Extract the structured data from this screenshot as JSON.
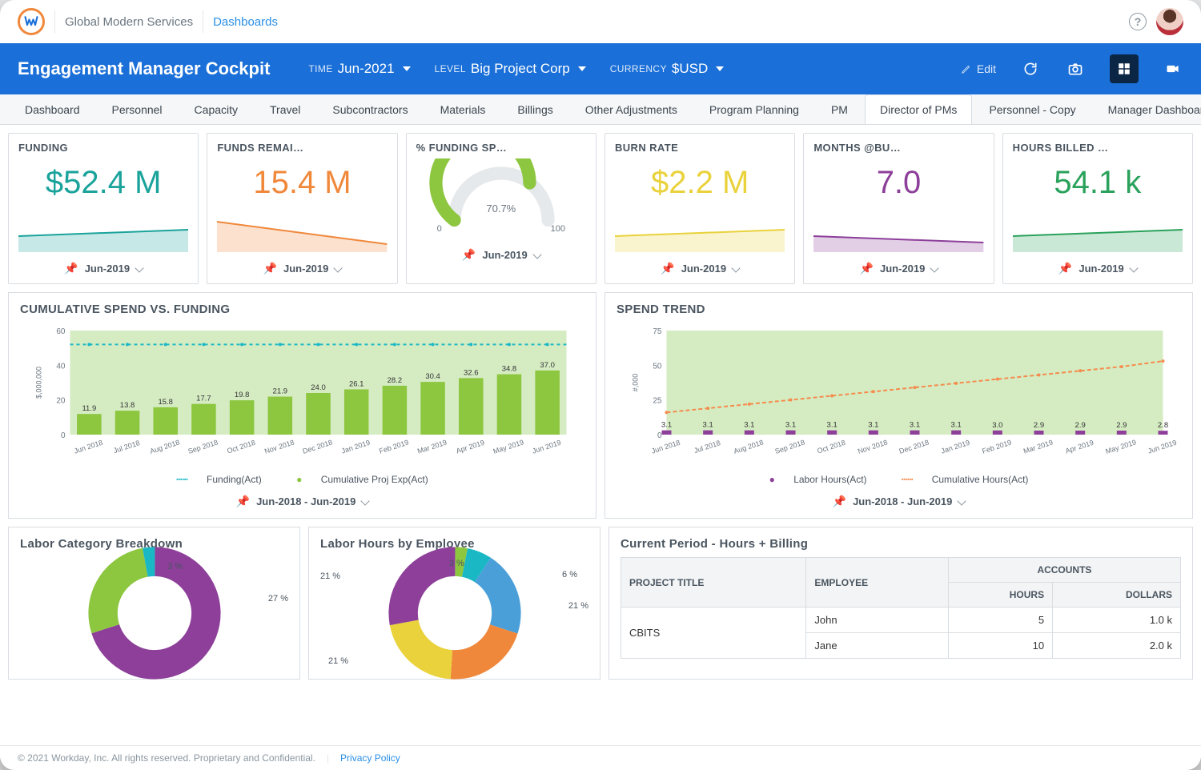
{
  "header": {
    "company": "Global Modern Services",
    "crumb": "Dashboards"
  },
  "bluebar": {
    "title": "Engagement Manager Cockpit",
    "filters": {
      "time": {
        "label": "TIME",
        "value": "Jun-2021"
      },
      "level": {
        "label": "LEVEL",
        "value": "Big Project Corp"
      },
      "currency": {
        "label": "CURRENCY",
        "value": "$USD"
      }
    },
    "edit": "Edit"
  },
  "tabs": [
    "Dashboard",
    "Personnel",
    "Capacity",
    "Travel",
    "Subcontractors",
    "Materials",
    "Billings",
    "Other Adjustments",
    "Program Planning",
    "PM",
    "Director of PMs",
    "Personnel - Copy",
    "Manager Dashboard"
  ],
  "tabs_active_index": 10,
  "kpis": [
    {
      "title": "FUNDING",
      "value": "$52.4 M",
      "color": "#1aa39b",
      "date": "Jun-2019"
    },
    {
      "title": "FUNDS REMAI…",
      "value": "15.4 M",
      "color": "#f0883b",
      "date": "Jun-2019"
    },
    {
      "title": "% FUNDING SP…",
      "value": "70.7%",
      "color": "#8dc63f",
      "gauge": true,
      "gauge_pct": 70.7,
      "gauge_min": "0",
      "gauge_max": "100",
      "date": "Jun-2019"
    },
    {
      "title": "BURN RATE",
      "value": "$2.2 M",
      "color": "#e9d23b",
      "date": "Jun-2019"
    },
    {
      "title": "MONTHS @BU…",
      "value": "7.0",
      "color": "#8d3f9a",
      "date": "Jun-2019"
    },
    {
      "title": "HOURS BILLED …",
      "value": "54.1 k",
      "color": "#2aa25b",
      "date": "Jun-2019"
    }
  ],
  "cumulative": {
    "title": "CUMULATIVE SPEND VS. FUNDING",
    "range": "Jun-2018 - Jun-2019",
    "legend_a": "Funding(Act)",
    "legend_b": "Cumulative Proj Exp(Act)",
    "ylabel": "$,000,000"
  },
  "spend_trend": {
    "title": "SPEND TREND",
    "range": "Jun-2018 - Jun-2019",
    "legend_a": "Labor Hours(Act)",
    "legend_b": "Cumulative Hours(Act)",
    "ylabel": "#,000"
  },
  "labor_cat": {
    "title": "Labor Category Breakdown"
  },
  "labor_emp": {
    "title": "Labor Hours by Employee"
  },
  "table": {
    "title": "Current Period - Hours + Billing",
    "hdr_project": "PROJECT TITLE",
    "hdr_employee": "EMPLOYEE",
    "hdr_accounts": "ACCOUNTS",
    "hdr_hours": "HOURS",
    "hdr_dollars": "DOLLARS",
    "project": "CBITS",
    "rows": [
      {
        "employee": "John",
        "hours": "5",
        "dollars": "1.0 k"
      },
      {
        "employee": "Jane",
        "hours": "10",
        "dollars": "2.0 k"
      }
    ]
  },
  "footer": {
    "copyright": "© 2021 Workday, Inc. All rights reserved. Proprietary and Confidential.",
    "link": "Privacy Policy"
  },
  "donut1_labels": {
    "a": "3 %",
    "b": "27 %"
  },
  "donut2_labels": {
    "a": "3 %",
    "b": "6 %",
    "c": "21 %",
    "d": "21 %",
    "e": "21 %"
  },
  "chart_data": [
    {
      "type": "bar",
      "title": "CUMULATIVE SPEND VS. FUNDING",
      "xlabel": "",
      "ylabel": "$,000,000",
      "ylim": [
        0,
        60
      ],
      "categories": [
        "Jun 2018",
        "Jul 2018",
        "Aug 2018",
        "Sep 2018",
        "Oct 2018",
        "Nov 2018",
        "Dec 2018",
        "Jan 2019",
        "Feb 2019",
        "Mar 2019",
        "Apr 2019",
        "May 2019",
        "Jun 2019"
      ],
      "series": [
        {
          "name": "Cumulative Proj Exp(Act)",
          "values": [
            11.9,
            13.8,
            15.8,
            17.7,
            19.8,
            21.9,
            24.0,
            26.1,
            28.2,
            30.4,
            32.6,
            34.8,
            37.0
          ]
        },
        {
          "name": "Funding(Act)",
          "values": [
            52,
            52,
            52,
            52,
            52,
            52,
            52,
            52,
            52,
            52,
            52,
            52,
            52
          ]
        }
      ]
    },
    {
      "type": "line",
      "title": "SPEND TREND",
      "xlabel": "",
      "ylabel": "#,000",
      "ylim": [
        0,
        75
      ],
      "categories": [
        "Jun 2018",
        "Jul 2018",
        "Aug 2018",
        "Sep 2018",
        "Oct 2018",
        "Nov 2018",
        "Dec 2018",
        "Jan 2019",
        "Feb 2019",
        "Mar 2019",
        "Apr 2019",
        "May 2019",
        "Jun 2019"
      ],
      "series": [
        {
          "name": "Labor Hours(Act)",
          "values": [
            3.1,
            3.1,
            3.1,
            3.1,
            3.1,
            3.1,
            3.1,
            3.1,
            3.0,
            2.9,
            2.9,
            2.9,
            2.8
          ]
        },
        {
          "name": "Cumulative Hours(Act)",
          "values": [
            16,
            19,
            22,
            25,
            28,
            31,
            34,
            37,
            40,
            43,
            46,
            49,
            53
          ]
        }
      ]
    },
    {
      "type": "pie",
      "title": "Labor Category Breakdown",
      "categories": [
        "Purple",
        "Green",
        "Teal"
      ],
      "values": [
        70,
        27,
        3
      ]
    },
    {
      "type": "pie",
      "title": "Labor Hours by Employee",
      "categories": [
        "Purple",
        "Green",
        "Teal",
        "Blue",
        "Orange",
        "Yellow",
        "DkPurple"
      ],
      "values": [
        28,
        3,
        6,
        21,
        21,
        21,
        17
      ]
    }
  ]
}
